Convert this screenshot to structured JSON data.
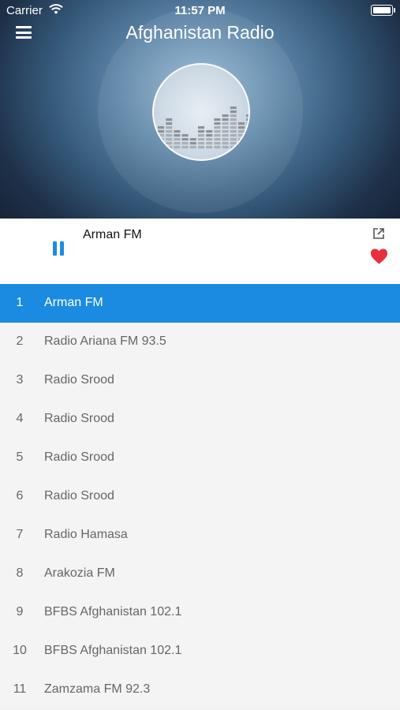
{
  "status_bar": {
    "carrier": "Carrier",
    "time": "11:57 PM",
    "icons": [
      "wifi-icon",
      "battery-icon"
    ]
  },
  "header": {
    "title": "Afghanistan Radio",
    "menu_icon": "hamburger-menu-icon",
    "logo_icon": "equalizer-logo-icon"
  },
  "player": {
    "now_playing": "Arman FM",
    "state": "playing",
    "controls": [
      "pause-icon",
      "share-icon",
      "heart-icon"
    ]
  },
  "stations": [
    {
      "num": "1",
      "name": "Arman FM",
      "active": true
    },
    {
      "num": "2",
      "name": "Radio Ariana FM 93.5"
    },
    {
      "num": "3",
      "name": "Radio Srood"
    },
    {
      "num": "4",
      "name": "Radio Srood"
    },
    {
      "num": "5",
      "name": "Radio Srood"
    },
    {
      "num": "6",
      "name": "Radio Srood"
    },
    {
      "num": "7",
      "name": "Radio Hamasa"
    },
    {
      "num": "8",
      "name": "Arakozia FM"
    },
    {
      "num": "9",
      "name": "BFBS Afghanistan 102.1"
    },
    {
      "num": "10",
      "name": "BFBS Afghanistan 102.1"
    },
    {
      "num": "11",
      "name": "Zamzama FM 92.3"
    }
  ],
  "colors": {
    "accent": "#1a8be0",
    "heart": "#e8303c",
    "list_bg": "#f4f4f4"
  }
}
